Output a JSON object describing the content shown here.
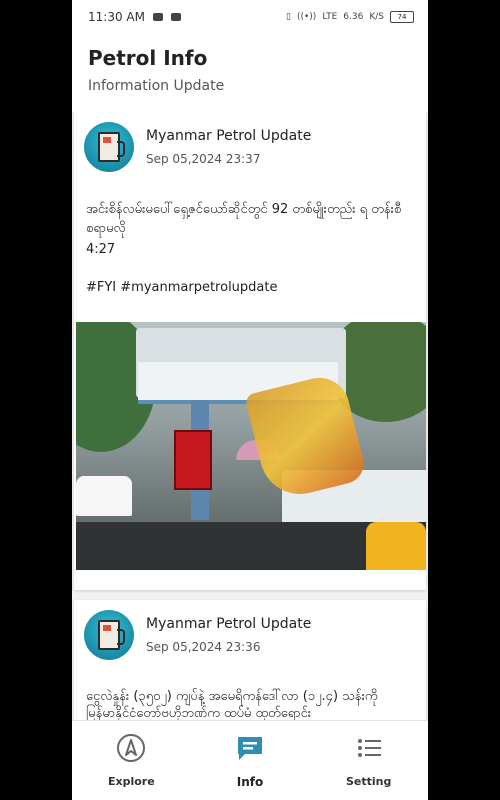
{
  "status_bar": {
    "time": "11:30 AM",
    "network": "LTE",
    "speed": "6.36",
    "speed_unit": "K/S",
    "battery": "74"
  },
  "header": {
    "title": "Petrol Info",
    "subtitle": "Information Update"
  },
  "posts": [
    {
      "author": "Myanmar Petrol Update",
      "time": "Sep 05,2024 23:37",
      "text": "အင်းစိန်လမ်းမပေါ်ရှေ့ဇင်ယော်ဆိုင်တွင် 92 တစ်မျိုးတည်း ရ တန်းစီစရာမလို",
      "duration": "4:27",
      "tags": "#FYI #myanmarpetrolupdate"
    },
    {
      "author": "Myanmar Petrol Update",
      "time": "Sep 05,2024 23:36",
      "text": "ငွေလဲနှုန်း (၃၅၀၂) ကျပ်နဲ့ အမေရိကန်ဒေါ်လာ (၁၂.၄) သန်းကို မြန်မာနိုင်ငံတော်ဗဟိုဘဏ်က ထပ်မံ ထုတ်ရောင်း"
    }
  ],
  "bottom_nav": {
    "items": [
      {
        "label": "Explore",
        "icon": "compass-icon",
        "active": false
      },
      {
        "label": "Info",
        "icon": "chat-icon",
        "active": true
      },
      {
        "label": "Setting",
        "icon": "settings-list-icon",
        "active": false
      }
    ]
  },
  "colors": {
    "accent": "#2f8fb3",
    "background": "#f2f2f2",
    "card": "#ffffff",
    "text": "#222222"
  }
}
